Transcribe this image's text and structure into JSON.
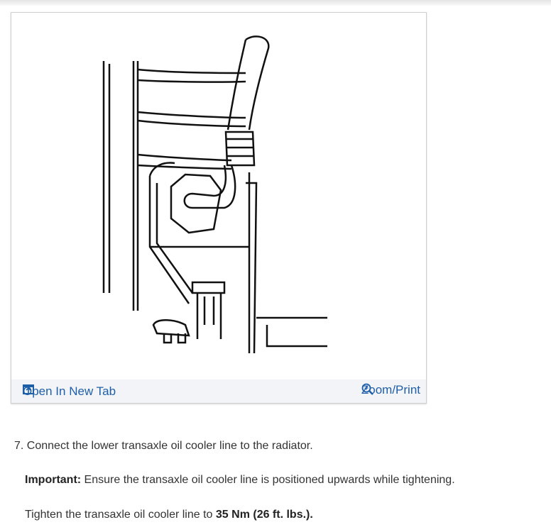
{
  "figure": {
    "open_link": "Open In New Tab",
    "zoom_link": "Zoom/Print"
  },
  "content": {
    "step_number": "7.",
    "step_text": "Connect the lower transaxle oil cooler line to the radiator.",
    "important_label": "Important:",
    "important_text": " Ensure the transaxle oil cooler line is positioned upwards while tightening.",
    "torque_prefix": "Tighten the transaxle oil cooler line to ",
    "torque_value": "35 Nm (26 ft. lbs.)",
    "torque_suffix": "."
  },
  "colors": {
    "link": "#1f5fa8",
    "footer_bg": "#f2f4f8"
  }
}
